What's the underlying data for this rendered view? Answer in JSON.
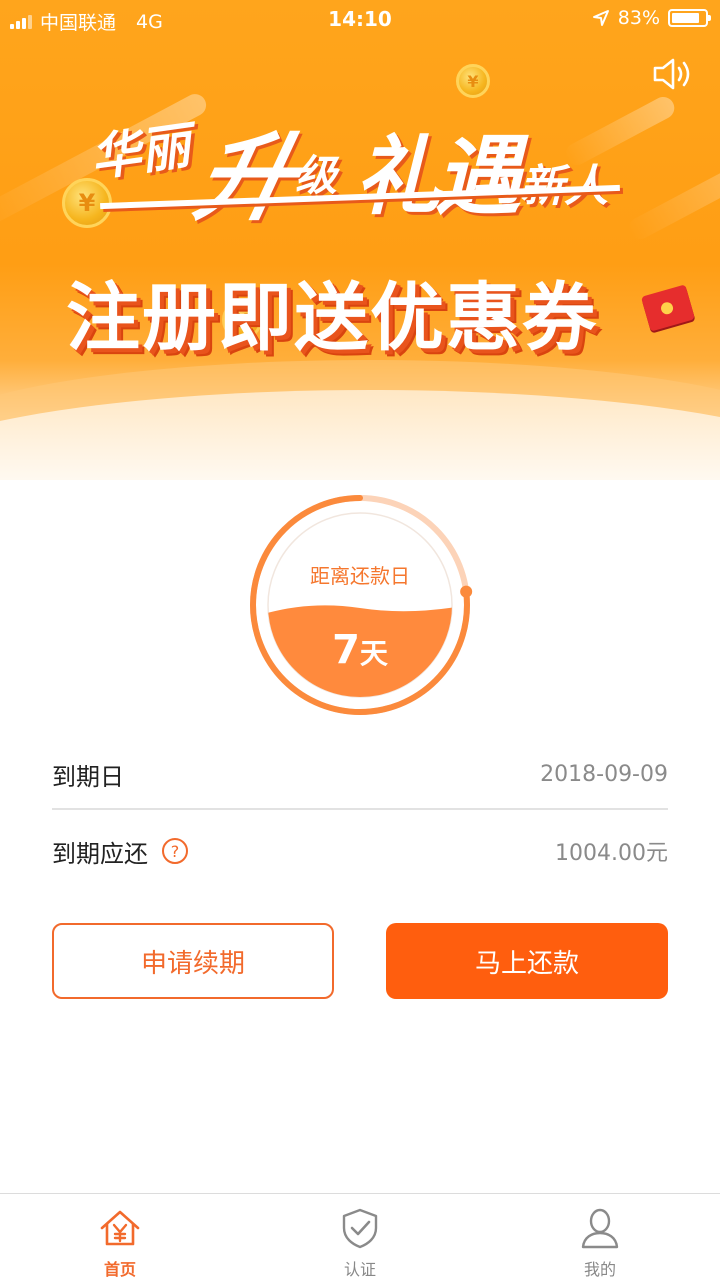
{
  "status_bar": {
    "carrier": "中国联通",
    "network": "4G",
    "time": "14:10",
    "battery": "83%",
    "battery_level": 0.83
  },
  "banner": {
    "headline_part1": "华丽",
    "headline_part2": "升",
    "headline_part3": "级",
    "headline_part4": "礼遇",
    "headline_part5": "新人",
    "subheadline": "注册即送优惠券",
    "sound_icon": "speaker-icon"
  },
  "countdown": {
    "label": "距离还款日",
    "days": "7",
    "unit": "天",
    "progress": 0.23
  },
  "info": {
    "due_date_label": "到期日",
    "due_date_value": "2018-09-09",
    "due_amount_label": "到期应还",
    "due_amount_help": "?",
    "due_amount_value": "1004.00元"
  },
  "actions": {
    "renew_label": "申请续期",
    "repay_label": "马上还款"
  },
  "tabs": [
    {
      "label": "首页",
      "icon": "home-yuan-icon",
      "active": true
    },
    {
      "label": "认证",
      "icon": "shield-check-icon",
      "active": false
    },
    {
      "label": "我的",
      "icon": "user-icon",
      "active": false
    }
  ],
  "colors": {
    "accent": "#ff5e0e",
    "accent_text": "#f26a2c",
    "banner": "#ffa51c"
  }
}
